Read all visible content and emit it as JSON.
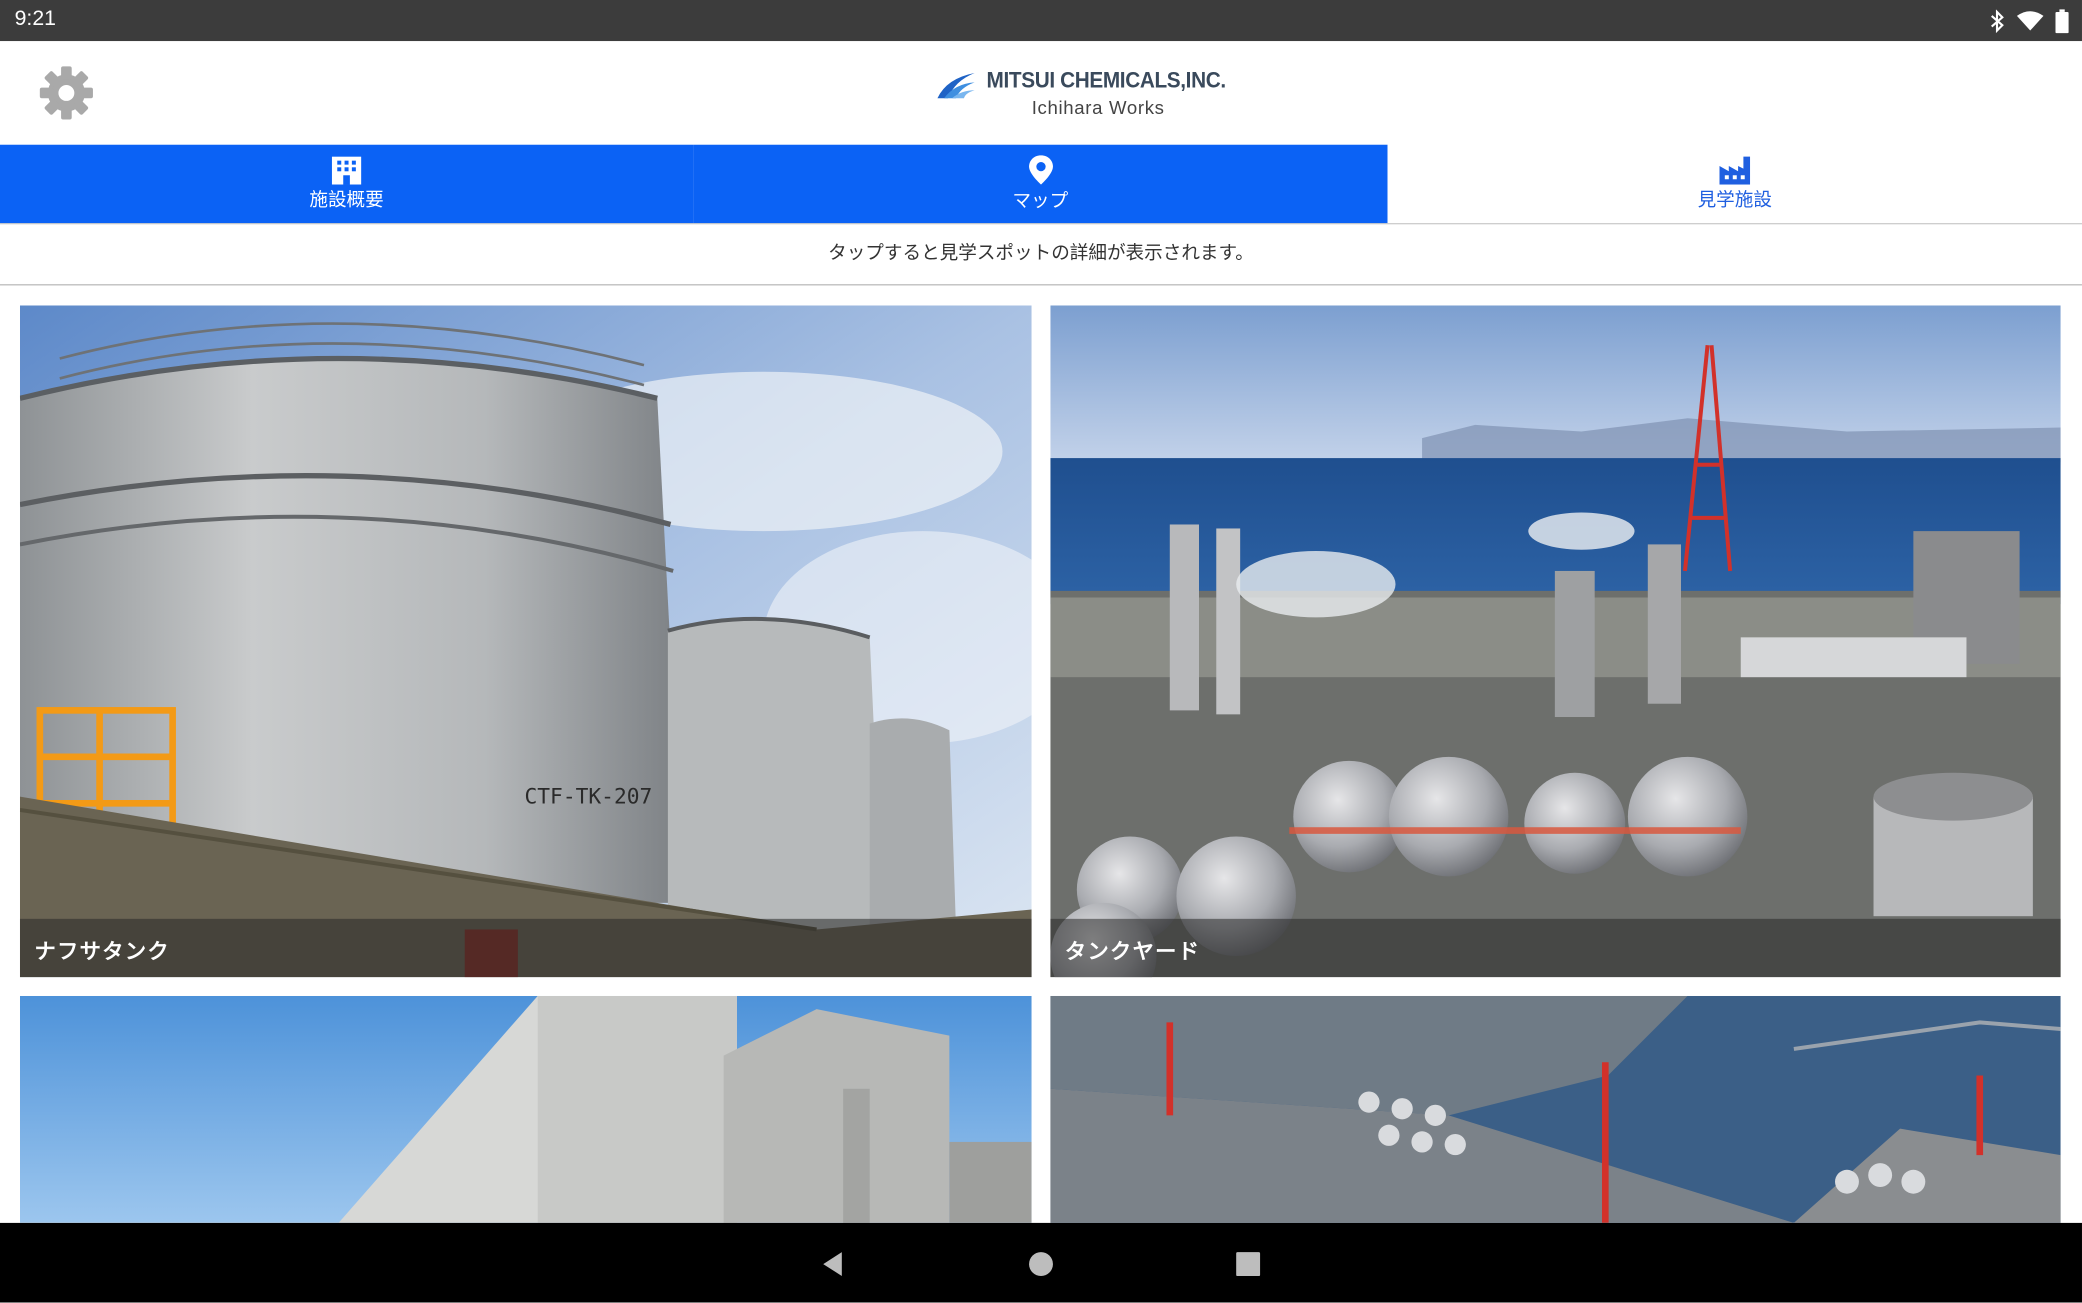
{
  "status_bar": {
    "time": "9:21"
  },
  "header": {
    "company": "MITSUI CHEMICALS,INC.",
    "works": "Ichihara Works"
  },
  "tabs": [
    {
      "label": "施設概要",
      "icon": "building-icon",
      "active": true
    },
    {
      "label": "マップ",
      "icon": "map-pin-icon",
      "active": true
    },
    {
      "label": "見学施設",
      "icon": "factory-icon",
      "active": false
    }
  ],
  "hint": "タップすると見学スポットの詳細が表示されます。",
  "spots": [
    {
      "caption": "ナフサタンク",
      "image": "naphtha-tank-photo",
      "tank_label": "CTF-TK-207"
    },
    {
      "caption": "タンクヤード",
      "image": "tank-yard-photo"
    },
    {
      "caption": "",
      "image": "concrete-building-photo"
    },
    {
      "caption": "",
      "image": "aerial-complex-photo"
    }
  ],
  "colors": {
    "accent": "#0b62f5",
    "status_bar": "#3c3c3c",
    "nav_bar": "#000000",
    "logo_blue": "#1f63c6"
  }
}
